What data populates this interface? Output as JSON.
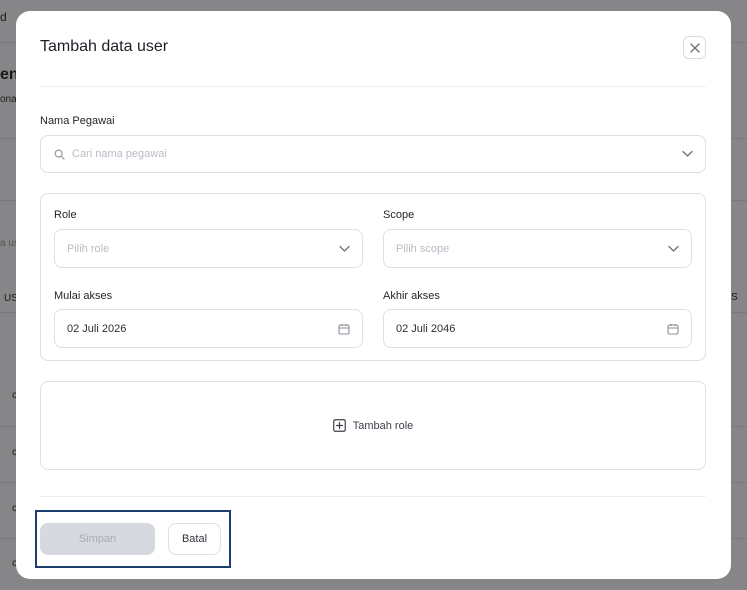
{
  "modal": {
    "title": "Tambah data user",
    "employee": {
      "label": "Nama Pegawai",
      "placeholder": "Cari nama pegawai"
    },
    "role": {
      "label": "Role",
      "placeholder": "Pilih role"
    },
    "scope": {
      "label": "Scope",
      "placeholder": "Pilih scope"
    },
    "access_start": {
      "label": "Mulai akses",
      "value": "02 Juli 2026"
    },
    "access_end": {
      "label": "Akhir akses",
      "value": "02 Juli 2046"
    },
    "add_role_label": "Tambah role",
    "save_label": "Simpan",
    "cancel_label": "Batal"
  },
  "background_fragments": {
    "top_left": "d",
    "heading": "en",
    "sub": "ona",
    "search": "a us",
    "col_left": "US",
    "col_right": "S",
    "rows": [
      "c",
      "c",
      "c",
      "c"
    ]
  },
  "colors": {
    "overlay": "#737373",
    "modal_bg": "#ffffff",
    "border": "#dcdfe4",
    "save_disabled_bg": "#d6dae0",
    "highlight": "#1d3f6e"
  }
}
